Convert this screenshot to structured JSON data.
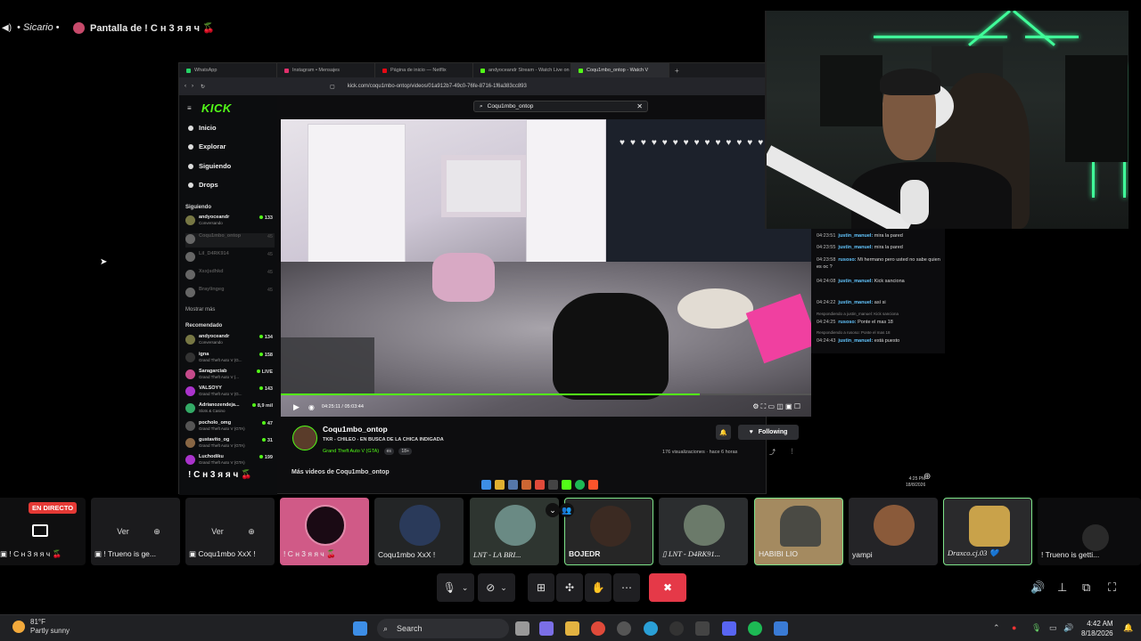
{
  "header": {
    "crumb_user": "• Sicario •",
    "screen_title": "Pantalla de ! C н 3 я я ч 🍒"
  },
  "browser": {
    "tabs": [
      {
        "label": "WhatsApp",
        "color": "#25d366"
      },
      {
        "label": "Instagram • Mensajes",
        "color": "#e1306c"
      },
      {
        "label": "Página de inicio — Netflix",
        "color": "#e50914"
      },
      {
        "label": "andyoceandr Stream - Watch Live on",
        "color": "#53fc18"
      },
      {
        "label": "Coqu1mbo_ontop - Watch V",
        "color": "#53fc18"
      }
    ],
    "url": "kick.com/coqu1mbo-ontop/videos/01a912b7-49c0-76fe-8716-1f6a383cc893"
  },
  "kick": {
    "logo": "KICK",
    "nav": [
      "Inicio",
      "Explorar",
      "Siguiendo",
      "Drops"
    ],
    "section_following": "Siguiendo",
    "following": [
      {
        "name": "andyoceandr",
        "sub": "Conversando",
        "count": "133"
      },
      {
        "name": "Coqu1mbo_ontop",
        "sub": "",
        "count": "45"
      },
      {
        "name": "Lil_D4RK914",
        "sub": "",
        "count": "45"
      },
      {
        "name": "Xsxjsdhkd",
        "sub": "",
        "count": "45"
      },
      {
        "name": "Braylingeg",
        "sub": "",
        "count": "45"
      }
    ],
    "show_more": "Mostrar más",
    "section_recommended": "Recomendado",
    "recommended": [
      {
        "name": "andyoceandr",
        "sub": "Conversando",
        "count": "134"
      },
      {
        "name": "igna",
        "sub": "Grand Theft Auto V (G...",
        "count": "158"
      },
      {
        "name": "Saragarciab",
        "sub": "Grand Theft Auto V (...",
        "count": "LIVE"
      },
      {
        "name": "VALSOYY",
        "sub": "Grand Theft Auto V (G...",
        "count": "143"
      },
      {
        "name": "Adrianozendeja...",
        "sub": "Slots & Casino",
        "count": "8,9 mil"
      },
      {
        "name": "pocholo_omg",
        "sub": "Grand Theft Auto V (GTA)",
        "count": "47"
      },
      {
        "name": "gustavito_og",
        "sub": "Grand Theft Auto V (GTA)",
        "count": "31"
      },
      {
        "name": "Luchodiku",
        "sub": "Grand Theft Auto V (GTA)",
        "count": "199"
      }
    ],
    "search_value": "Coqu1mbo_ontop",
    "video_time": "04:25:11 / 05:03:44",
    "video_progress": 0.79,
    "channel": "Coqu1mbo_ontop",
    "stream_title": "TKR - CHILEO - EN BUSCA DE LA CHICA INDIGADA",
    "category": "Grand Theft Auto V (GTA)",
    "tag_lang": "es",
    "tag_age": "18+",
    "views": "176 visualizaciones · hace 6 horas",
    "follow_label": "Following",
    "more_videos": "Más videos de Coqu1mbo_ontop",
    "watermark": "! C н 3 я я ч 🍒"
  },
  "chat": {
    "messages": [
      {
        "time": "04:23:51",
        "user": "justin_manuel:",
        "text": "mira la pared",
        "color": "#63c6ff"
      },
      {
        "time": "04:23:55",
        "user": "justin_manuel:",
        "text": "mira la pared",
        "color": "#63c6ff"
      },
      {
        "time": "04:23:58",
        "user": "rusoso:",
        "text": "Mi hermano pero usted no sabe quien es oc ?",
        "color": "#63c6ff"
      },
      {
        "time": "04:24:08",
        "user": "justin_manuel:",
        "text": "Kick sanciona",
        "color": "#63c6ff"
      },
      {
        "time": "04:24:22",
        "user": "justin_manuel:",
        "text": "así si",
        "color": "#63c6ff"
      },
      {
        "time": "04:24:25",
        "user": "rusoso:",
        "text": "Ponte el mas 18",
        "color": "#63c6ff"
      },
      {
        "time": "04:24:43",
        "user": "justin_manuel:",
        "text": "está puesto",
        "color": "#63c6ff"
      }
    ],
    "reply1": "Respondiendo a justin_manuel: Kick sanciona",
    "reply2": "Respondiendo a rusoso: Ponte el mas 18"
  },
  "share_clock": {
    "time": "4:25 PM",
    "date": "18/8/2026"
  },
  "participants": [
    {
      "label": "! C н 3 я я ч 🍒",
      "live": "EN DIRECTO"
    },
    {
      "label": "! Trueno is ge...",
      "btn": "Ver"
    },
    {
      "label": "Coqu1mbo XxX !",
      "btn": "Ver"
    },
    {
      "label": "! C н 3 я я ч 🍒",
      "bg": "#d05a87"
    },
    {
      "label": "Coqu1mbo XxX !"
    },
    {
      "label": "LNT - LA BRI..."
    },
    {
      "label": "BOJEDR"
    },
    {
      "label": "LNT - D4RK91..."
    },
    {
      "label": "HABIBI LIO"
    },
    {
      "label": "yampi"
    },
    {
      "label": "Draxco.cj.03 💙"
    },
    {
      "label": "! Trueno is getti..."
    }
  ],
  "taskbar": {
    "temp": "81°F",
    "weather": "Partly sunny",
    "search": "Search",
    "time": "4:42 AM",
    "date": "8/18/2026"
  }
}
